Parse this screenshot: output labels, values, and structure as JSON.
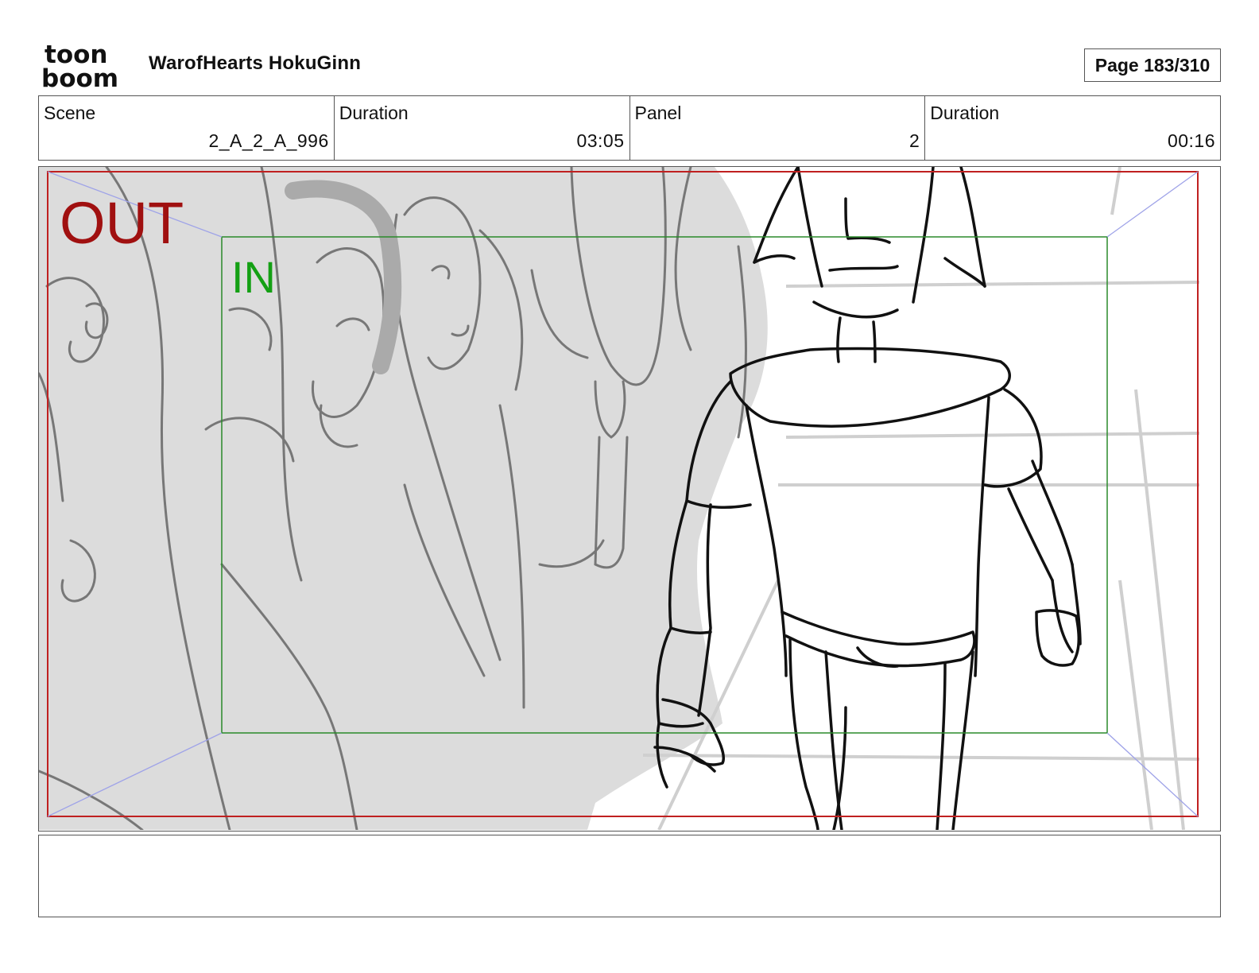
{
  "header": {
    "logo_top": "toon",
    "logo_bottom": "boom",
    "project_title": "WarofHearts HokuGinn",
    "page_label": "Page 183/310"
  },
  "info": {
    "scene_label": "Scene",
    "scene_value": "2_A_2_A_996",
    "scene_duration_label": "Duration",
    "scene_duration_value": "03:05",
    "panel_label": "Panel",
    "panel_value": "2",
    "panel_duration_label": "Duration",
    "panel_duration_value": "00:16"
  },
  "panel": {
    "out_label": "OUT",
    "in_label": "IN",
    "out_color": "#a01010",
    "in_color": "#14a014"
  },
  "notes": {
    "text": ""
  }
}
